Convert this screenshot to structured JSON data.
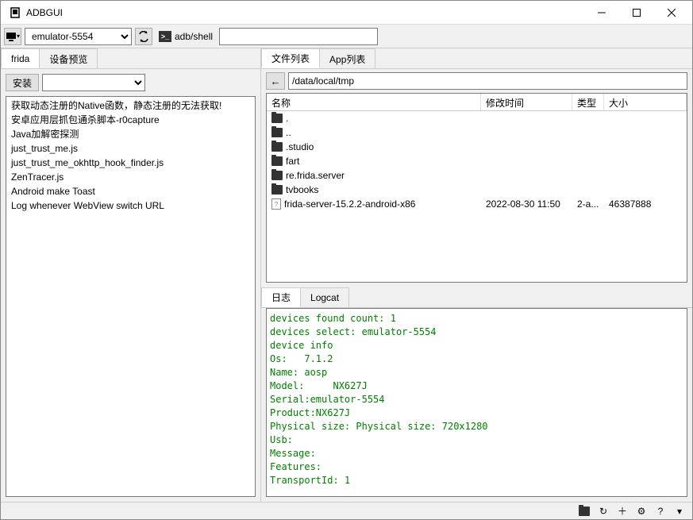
{
  "window": {
    "title": "ADBGUI"
  },
  "toolbar": {
    "device": "emulator-5554",
    "shell_label": "adb/shell",
    "shell_value": ""
  },
  "left": {
    "tabs": [
      "frida",
      "设备预览"
    ],
    "active_tab": 0,
    "install_label": "安装",
    "scripts": [
      "获取动态注册的Native函数，静态注册的无法获取!",
      "安卓应用层抓包通杀脚本-r0capture",
      "Java加解密探测",
      "just_trust_me.js",
      "just_trust_me_okhttp_hook_finder.js",
      "ZenTracer.js",
      "Android make Toast",
      "Log whenever WebView switch URL"
    ]
  },
  "right": {
    "tabs": [
      "文件列表",
      "App列表"
    ],
    "active_tab": 0,
    "path": "/data/local/tmp",
    "columns": {
      "name": "名称",
      "mtime": "修改时间",
      "type": "类型",
      "size": "大小"
    },
    "files": [
      {
        "icon": "folder",
        "name": ".",
        "mtime": "",
        "type": "",
        "size": ""
      },
      {
        "icon": "folder",
        "name": "..",
        "mtime": "",
        "type": "",
        "size": ""
      },
      {
        "icon": "folder",
        "name": ".studio",
        "mtime": "",
        "type": "",
        "size": ""
      },
      {
        "icon": "folder",
        "name": "fart",
        "mtime": "",
        "type": "",
        "size": ""
      },
      {
        "icon": "folder",
        "name": "re.frida.server",
        "mtime": "",
        "type": "",
        "size": ""
      },
      {
        "icon": "folder",
        "name": "tvbooks",
        "mtime": "",
        "type": "",
        "size": ""
      },
      {
        "icon": "file",
        "name": "frida-server-15.2.2-android-x86",
        "mtime": "2022-08-30 11:50",
        "type": "2-a...",
        "size": "46387888"
      }
    ]
  },
  "log": {
    "tabs": [
      "日志",
      "Logcat"
    ],
    "active_tab": 0,
    "lines": [
      "devices found count: 1",
      "devices select: emulator-5554",
      "device info",
      "Os:   7.1.2",
      "Name: aosp",
      "Model:     NX627J",
      "Serial:emulator-5554",
      "Product:NX627J",
      "Physical size: Physical size: 720x1280",
      "Usb:",
      "Message:",
      "Features:",
      "TransportId: 1"
    ]
  }
}
